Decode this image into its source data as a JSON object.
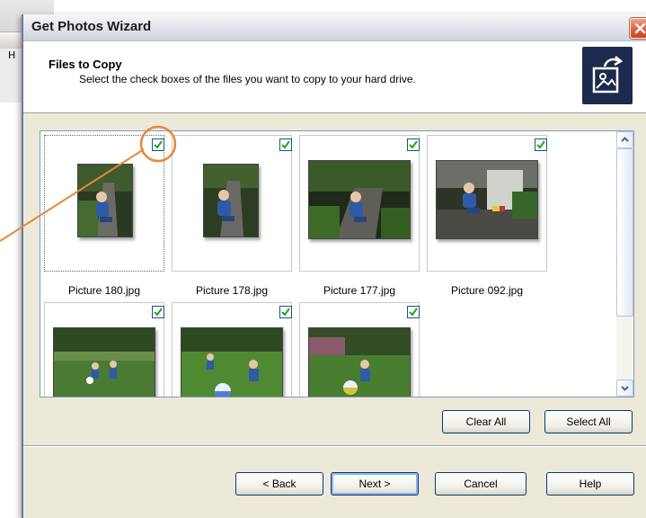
{
  "background_window": {
    "partial_label": "H"
  },
  "window": {
    "title": "Get Photos Wizard",
    "close_icon": "close-x-icon"
  },
  "header": {
    "title": "Files to Copy",
    "subtitle": "Select the check boxes of the files you want to copy to your hard drive.",
    "icon": "copy-photo-icon"
  },
  "photos": [
    {
      "name": "Picture 180.jpg",
      "checked": true
    },
    {
      "name": "Picture 178.jpg",
      "checked": true
    },
    {
      "name": "Picture 177.jpg",
      "checked": true
    },
    {
      "name": "Picture 092.jpg",
      "checked": true
    },
    {
      "name": "",
      "checked": true
    },
    {
      "name": "",
      "checked": true
    },
    {
      "name": "",
      "checked": true
    }
  ],
  "buttons": {
    "clear_all": "Clear All",
    "select_all": "Select All",
    "back": "< Back",
    "next": "Next >",
    "cancel": "Cancel",
    "help": "Help"
  },
  "colors": {
    "annotation": "#e8873a",
    "title_close": "#e0603e",
    "checkbox_check": "#21a121"
  }
}
